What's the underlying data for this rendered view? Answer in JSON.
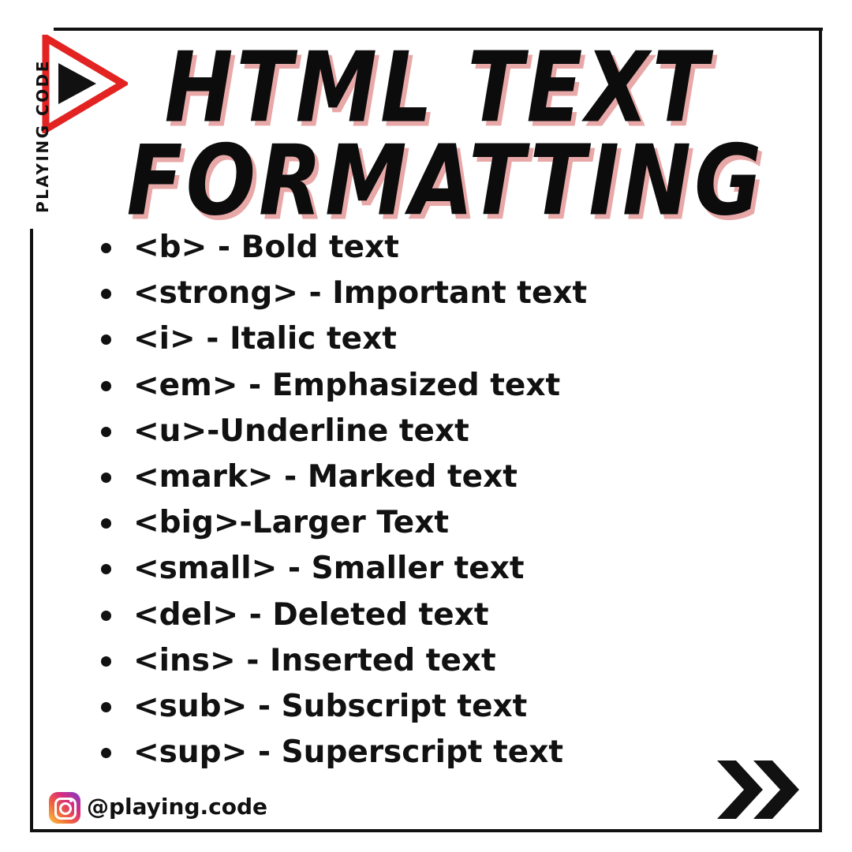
{
  "brand": {
    "name": "PLAYING CODE",
    "logo_icon": "play-triangle-icon",
    "accent": "#e32222"
  },
  "title": {
    "line1": "HTML TEXT",
    "line2": "FORMATTING",
    "shadow_color": "#e9a8a8"
  },
  "items": [
    {
      "text": "<b> - Bold text"
    },
    {
      "text": "<strong> - Important text"
    },
    {
      "text": "<i> - Italic text"
    },
    {
      "text": "<em> - Emphasized text"
    },
    {
      "text": "<u>-Underline text"
    },
    {
      "text": "<mark> - Marked text"
    },
    {
      "text": "<big>-Larger Text"
    },
    {
      "text": "<small> - Smaller text"
    },
    {
      "text": "<del> - Deleted text"
    },
    {
      "text": "<ins> - Inserted text"
    },
    {
      "text": "<sub> - Subscript text"
    },
    {
      "text": "<sup> - Superscript text"
    }
  ],
  "footer": {
    "handle": "@playing.code",
    "social_icon": "instagram-icon",
    "next_icon": "double-chevron-right-icon"
  }
}
